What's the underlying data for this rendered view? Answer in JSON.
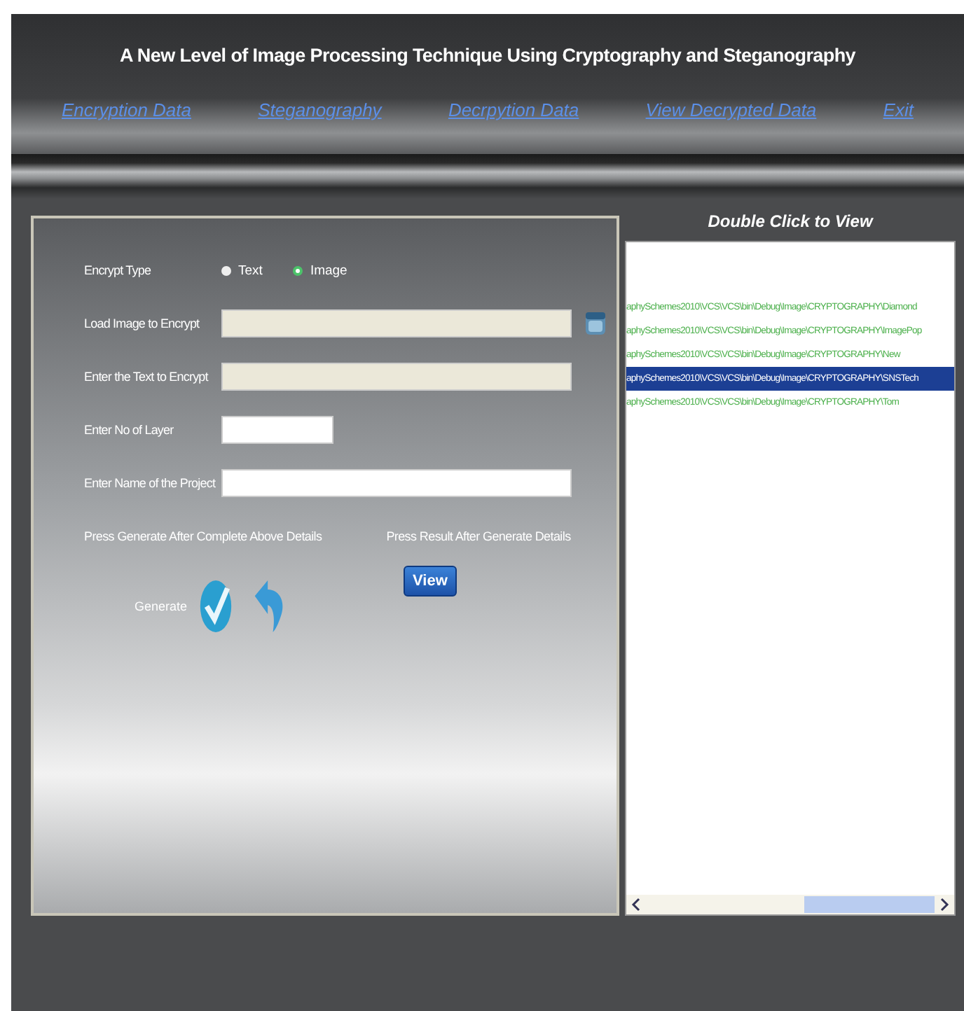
{
  "header": {
    "title": "A New Level of Image Processing Technique Using Cryptography and Steganography"
  },
  "nav": [
    {
      "label": "Encryption Data"
    },
    {
      "label": "Steganography"
    },
    {
      "label": "Decrpytion Data"
    },
    {
      "label": "View Decrypted Data"
    },
    {
      "label": "Exit"
    }
  ],
  "form": {
    "encrypt_type": {
      "label": "Encrypt Type",
      "options": [
        {
          "label": "Text",
          "selected": false
        },
        {
          "label": "Image",
          "selected": true
        }
      ]
    },
    "fields": [
      {
        "label": "Load Image to Encrypt",
        "kind": "wide",
        "disabled": true,
        "browse": true
      },
      {
        "label": "Enter the Text to Encrypt",
        "kind": "wide",
        "disabled": true,
        "browse": false
      },
      {
        "label": "Enter No of Layer",
        "kind": "short",
        "disabled": false,
        "browse": false
      },
      {
        "label": "Enter Name of the Project",
        "kind": "wide",
        "disabled": false,
        "browse": false
      }
    ],
    "generate_hint": "Press Generate After Complete Above Details",
    "result_hint": "Press Result After Generate Details",
    "generate_label": "Generate",
    "view_button": "View"
  },
  "list_panel": {
    "title": "Double Click to View",
    "items": [
      {
        "text": "aphySchemes2010\\VCS\\VCS\\bin\\Debug\\Image\\CRYPTOGRAPHY\\Diamond",
        "selected": false
      },
      {
        "text": "aphySchemes2010\\VCS\\VCS\\bin\\Debug\\Image\\CRYPTOGRAPHY\\ImagePop",
        "selected": false
      },
      {
        "text": "aphySchemes2010\\VCS\\VCS\\bin\\Debug\\Image\\CRYPTOGRAPHY\\New",
        "selected": false
      },
      {
        "text": "aphySchemes2010\\VCS\\VCS\\bin\\Debug\\Image\\CRYPTOGRAPHY\\SNSTech",
        "selected": true
      },
      {
        "text": "aphySchemes2010\\VCS\\VCS\\bin\\Debug\\Image\\CRYPTOGRAPHY\\Tom",
        "selected": false
      }
    ]
  }
}
